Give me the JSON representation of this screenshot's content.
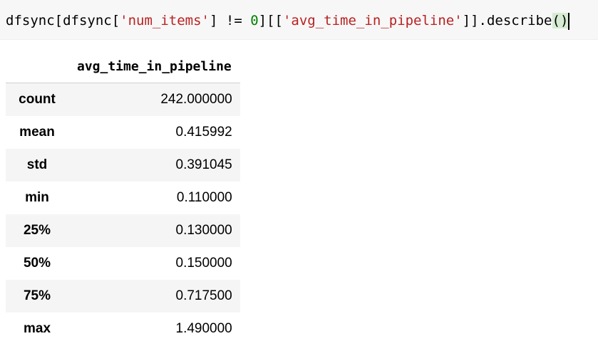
{
  "code_cell": {
    "tokens": [
      {
        "text": "dfsync[dfsync[",
        "kind": "op"
      },
      {
        "text": "'num_items'",
        "kind": "str"
      },
      {
        "text": "] != ",
        "kind": "op"
      },
      {
        "text": "0",
        "kind": "num"
      },
      {
        "text": "][[",
        "kind": "op"
      },
      {
        "text": "'avg_time_in_pipeline'",
        "kind": "str"
      },
      {
        "text": "]].describe",
        "kind": "op"
      },
      {
        "text": "(",
        "kind": "paren"
      },
      {
        "text": ")",
        "kind": "paren"
      }
    ]
  },
  "table": {
    "column_header": "avg_time_in_pipeline",
    "rows": [
      {
        "label": "count",
        "value": "242.000000"
      },
      {
        "label": "mean",
        "value": "0.415992"
      },
      {
        "label": "std",
        "value": "0.391045"
      },
      {
        "label": "min",
        "value": "0.110000"
      },
      {
        "label": "25%",
        "value": "0.130000"
      },
      {
        "label": "50%",
        "value": "0.150000"
      },
      {
        "label": "75%",
        "value": "0.717500"
      },
      {
        "label": "max",
        "value": "1.490000"
      }
    ]
  },
  "colors": {
    "string": "#ba2121",
    "number": "#008000",
    "paren_match_bg": "#d7ebd3",
    "cell_bg": "#f7f7f7",
    "row_stripe": "#f5f5f5"
  }
}
